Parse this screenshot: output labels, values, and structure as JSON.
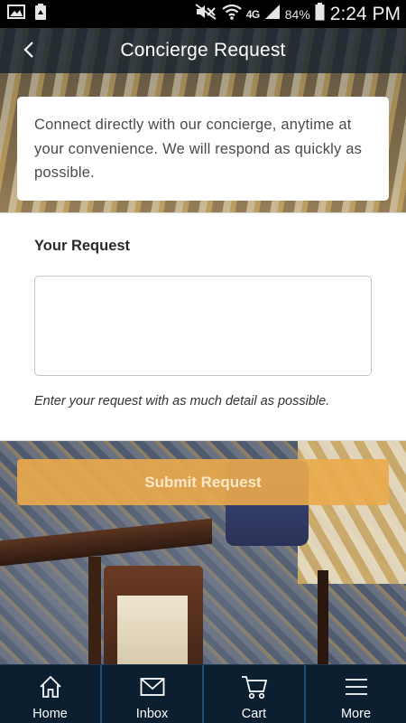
{
  "status_bar": {
    "network": "4G",
    "battery": "84%",
    "time": "2:24 PM",
    "icons": [
      "image-icon",
      "recycle-icon",
      "mute-icon",
      "wifi-icon",
      "signal-icon",
      "battery-icon"
    ]
  },
  "header": {
    "title": "Concierge Request",
    "back_icon": "chevron-left-icon"
  },
  "intro": {
    "text": "Connect directly with our concierge, anytime at your convenience. We will respond as quickly as possible."
  },
  "form": {
    "label": "Your Request",
    "textarea_value": "",
    "hint": "Enter your request with as much detail as possible."
  },
  "submit": {
    "label": "Submit Request",
    "color": "#EBAA4B"
  },
  "tabs": [
    {
      "label": "Home",
      "icon": "home-icon"
    },
    {
      "label": "Inbox",
      "icon": "mail-icon"
    },
    {
      "label": "Cart",
      "icon": "cart-icon"
    },
    {
      "label": "More",
      "icon": "menu-icon"
    }
  ],
  "colors": {
    "header_bg": "#142230",
    "tab_bar_bg": "#0B1F30",
    "tab_divider": "#1F4D7A"
  }
}
